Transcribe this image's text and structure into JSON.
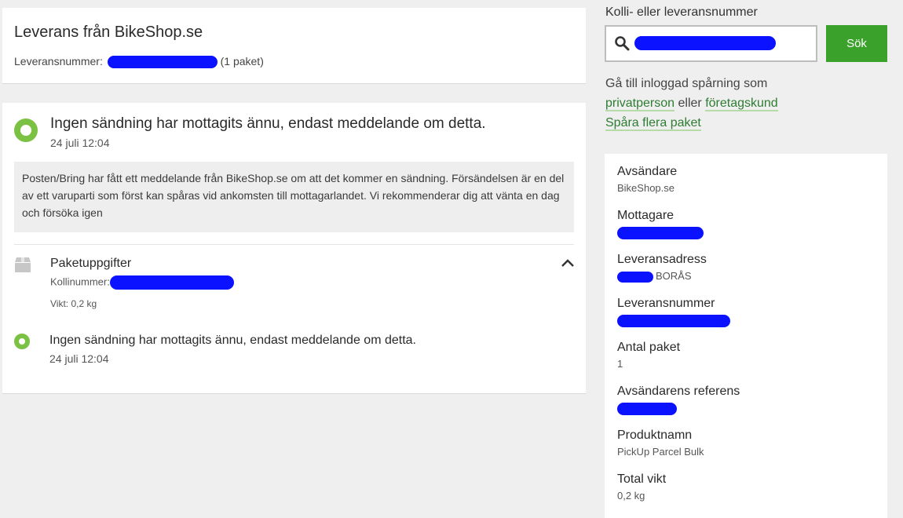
{
  "header": {
    "title": "Leverans från BikeShop.se",
    "delivery_number_label": "Leveransnummer:",
    "package_count": "(1 paket)"
  },
  "event": {
    "status": "Ingen sändning har mottagits ännu, endast meddelande om detta.",
    "date": "24 juli 12:04",
    "info_text": "Posten/Bring har fått ett meddelande från BikeShop.se om att det kommer en sändning. Försändelsen är en del av ett varuparti som först kan spåras vid ankomsten till mottagarlandet. Vi rekommenderar dig att vänta en dag och försöka igen"
  },
  "package": {
    "title": "Paketuppgifter",
    "kolli_label": "Kollinummer:",
    "weight": "Vikt: 0,2 kg",
    "event_status": "Ingen sändning har mottagits ännu, endast meddelande om detta.",
    "event_date": "24 juli 12:04"
  },
  "search": {
    "label": "Kolli- eller leveransnummer",
    "button": "Sök"
  },
  "login": {
    "prefix": "Gå till inloggad spårning som",
    "private_link": "privatperson",
    "or": "eller",
    "business_link": "företagskund",
    "track_more": "Spåra flera paket"
  },
  "details": [
    {
      "label": "Avsändare",
      "value": "BikeShop.se"
    },
    {
      "label": "Mottagare",
      "value": ""
    },
    {
      "label": "Leveransadress",
      "value": "BORÅS"
    },
    {
      "label": "Leveransnummer",
      "value": ""
    },
    {
      "label": "Antal paket",
      "value": "1"
    },
    {
      "label": "Avsändarens referens",
      "value": ""
    },
    {
      "label": "Produktnamn",
      "value": "PickUp Parcel Bulk"
    },
    {
      "label": "Total vikt",
      "value": "0,2 kg"
    }
  ],
  "colors": {
    "accent_green": "#3aa12b",
    "status_green": "#7bc143",
    "link_green": "#2e7d32",
    "redaction_blue": "#0a12ff"
  },
  "icons": [
    "search-icon",
    "package-icon",
    "chevron-up-icon",
    "status-dot-icon"
  ]
}
